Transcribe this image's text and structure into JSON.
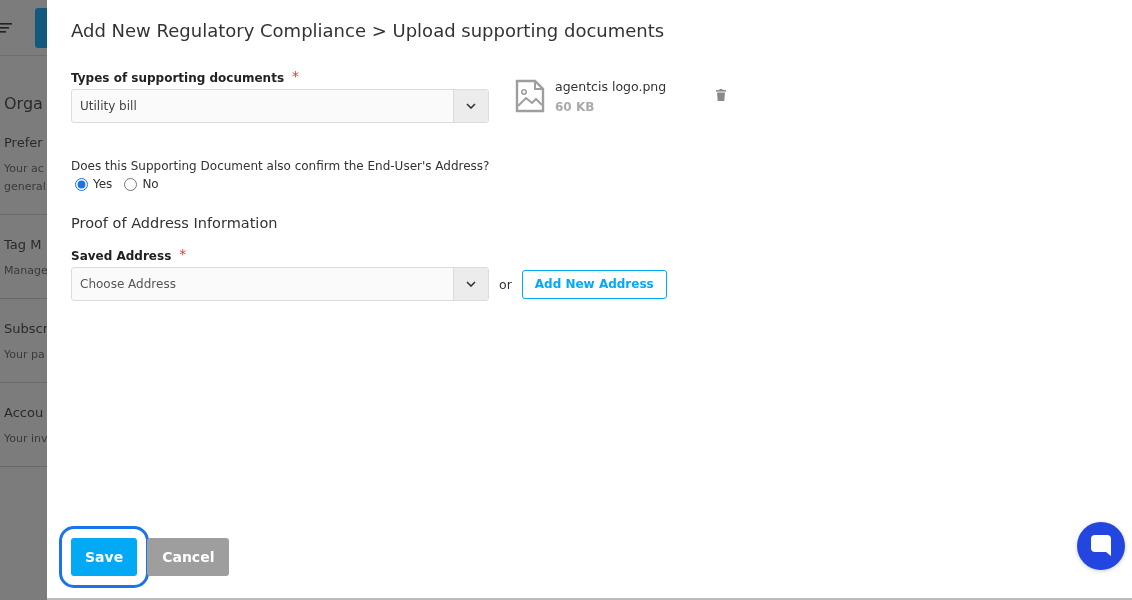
{
  "background_page": {
    "heading": "Orga",
    "sections": [
      {
        "title": "Prefer",
        "lines": [
          "Your ac",
          "general"
        ]
      },
      {
        "title": "Tag M",
        "lines": [
          "Manage"
        ]
      },
      {
        "title": "Subscr",
        "lines": [
          "Your pa"
        ]
      },
      {
        "title": "Accou",
        "lines": [
          "Your inv"
        ]
      }
    ]
  },
  "drawer": {
    "title": "Add New Regulatory Compliance > Upload supporting documents",
    "document_type": {
      "label": "Types of supporting documents",
      "required_mark": "*",
      "value": "Utility bill"
    },
    "file": {
      "name": "agentcis logo.png",
      "size": "60 KB"
    },
    "address_question": {
      "label": "Does this Supporting Document also confirm the End-User's Address?",
      "options": [
        {
          "label": "Yes",
          "selected": true
        },
        {
          "label": "No",
          "selected": false
        }
      ]
    },
    "section_title": "Proof of Address Information",
    "saved_address": {
      "label": "Saved Address",
      "required_mark": "*",
      "placeholder": "Choose Address"
    },
    "or_text": "or",
    "add_address_button": "Add New Address",
    "buttons": [
      {
        "label": "Save",
        "kind": "primary",
        "focused": true
      },
      {
        "label": "Cancel",
        "kind": "secondary",
        "focused": false
      }
    ]
  }
}
